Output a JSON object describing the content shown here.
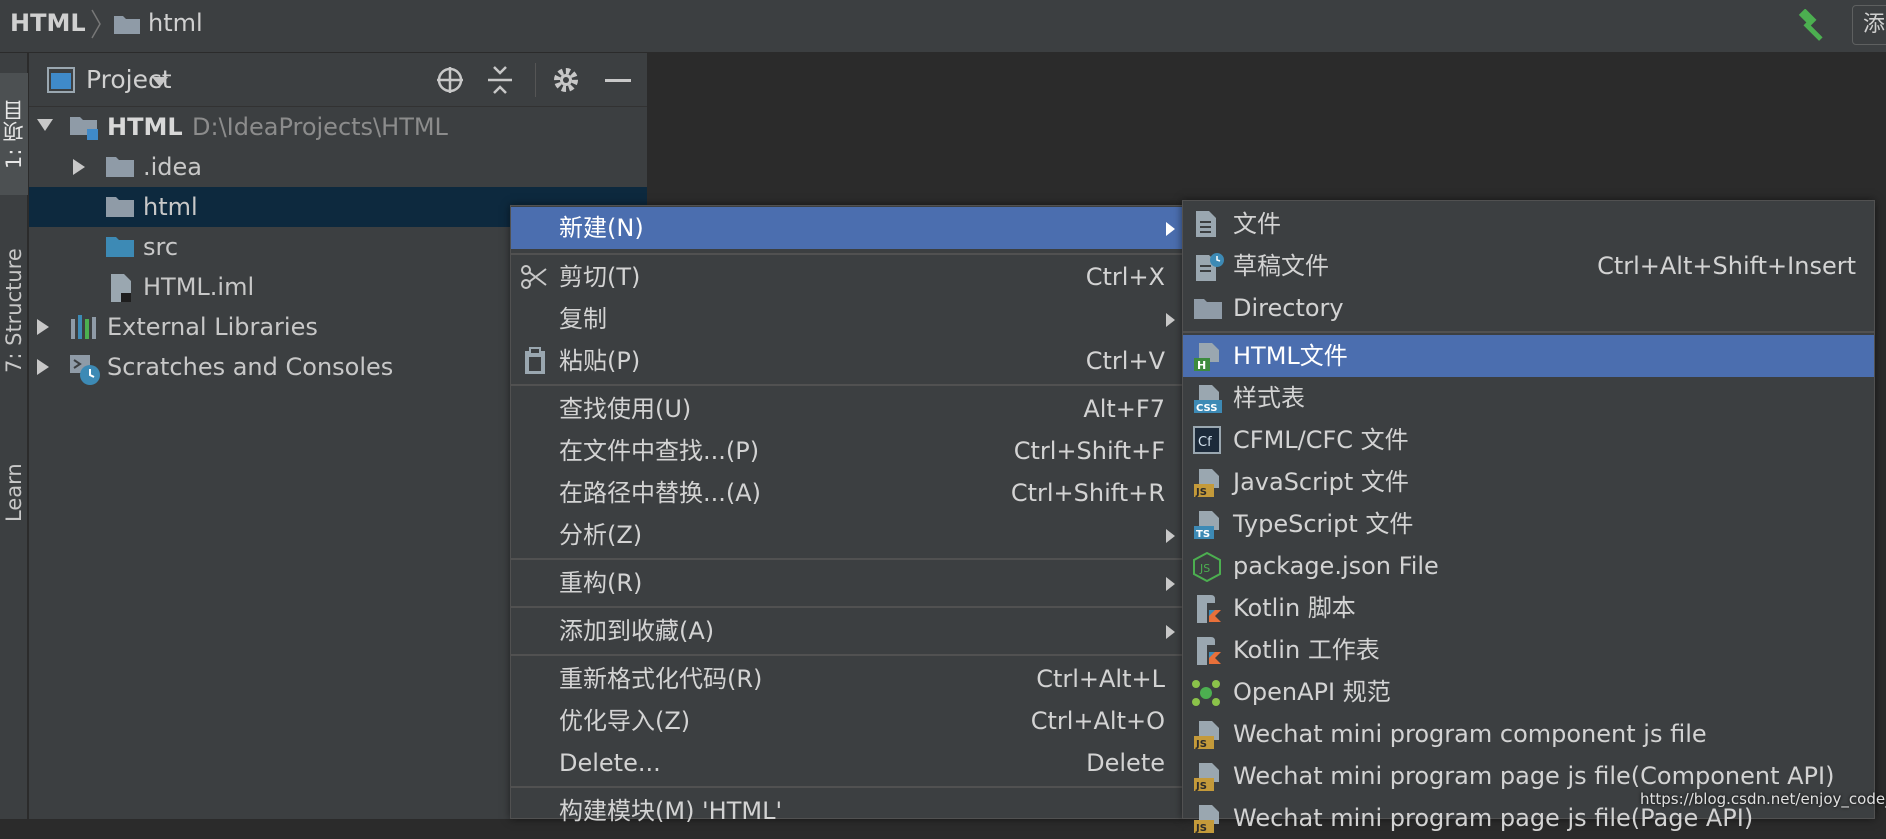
{
  "breadcrumb": {
    "root": "HTML",
    "child": "html"
  },
  "toolbar": {
    "add_config_label": "添"
  },
  "left_strip": {
    "project_tab": "1: 项目",
    "structure_tab": "7: Structure",
    "learn_tab": "Learn"
  },
  "project_panel": {
    "title": "Project",
    "tree": [
      {
        "label": "HTML",
        "path": "D:\\IdeaProjects\\HTML"
      },
      {
        "label": ".idea"
      },
      {
        "label": "html"
      },
      {
        "label": "src"
      },
      {
        "label": "HTML.iml"
      },
      {
        "label": "External Libraries"
      },
      {
        "label": "Scratches and Consoles"
      }
    ]
  },
  "context_menu": {
    "items": [
      {
        "label": "新建(N)",
        "shortcut": ""
      },
      {
        "label": "剪切(T)",
        "shortcut": "Ctrl+X"
      },
      {
        "label": "复制",
        "shortcut": ""
      },
      {
        "label": "粘贴(P)",
        "shortcut": "Ctrl+V"
      },
      {
        "label": "查找使用(U)",
        "shortcut": "Alt+F7"
      },
      {
        "label": "在文件中查找...(P)",
        "shortcut": "Ctrl+Shift+F"
      },
      {
        "label": "在路径中替换...(A)",
        "shortcut": "Ctrl+Shift+R"
      },
      {
        "label": "分析(Z)",
        "shortcut": ""
      },
      {
        "label": "重构(R)",
        "shortcut": ""
      },
      {
        "label": "添加到收藏(A)",
        "shortcut": ""
      },
      {
        "label": "重新格式化代码(R)",
        "shortcut": "Ctrl+Alt+L"
      },
      {
        "label": "优化导入(Z)",
        "shortcut": "Ctrl+Alt+O"
      },
      {
        "label": "Delete...",
        "shortcut": "Delete"
      },
      {
        "label": "构建模块(M) 'HTML'",
        "shortcut": ""
      }
    ]
  },
  "submenu": {
    "items": [
      {
        "label": "文件",
        "shortcut": ""
      },
      {
        "label": "草稿文件",
        "shortcut": "Ctrl+Alt+Shift+Insert"
      },
      {
        "label": "Directory",
        "shortcut": ""
      },
      {
        "label": "HTML文件",
        "shortcut": ""
      },
      {
        "label": "样式表",
        "shortcut": ""
      },
      {
        "label": "CFML/CFC 文件",
        "shortcut": ""
      },
      {
        "label": "JavaScript 文件",
        "shortcut": ""
      },
      {
        "label": "TypeScript 文件",
        "shortcut": ""
      },
      {
        "label": "package.json File",
        "shortcut": ""
      },
      {
        "label": "Kotlin 脚本",
        "shortcut": ""
      },
      {
        "label": "Kotlin 工作表",
        "shortcut": ""
      },
      {
        "label": "OpenAPI 规范",
        "shortcut": ""
      },
      {
        "label": "Wechat mini program component js file",
        "shortcut": ""
      },
      {
        "label": "Wechat mini program page js file(Component API)",
        "shortcut": ""
      },
      {
        "label": "Wechat mini program page js file(Page API)",
        "shortcut": ""
      }
    ]
  },
  "icons": {
    "colors": {
      "folder": "#8f9ba7",
      "highlight": "#4b6eaf",
      "selection": "#0d293e",
      "hammer": "#4caf50",
      "html_badge": "#3e8b3e",
      "css_badge": "#3d8ab5",
      "js_badge": "#c49a3a",
      "ts_badge": "#3d8ab5"
    }
  },
  "watermark": "https://blog.csdn.net/enjoy_code_"
}
